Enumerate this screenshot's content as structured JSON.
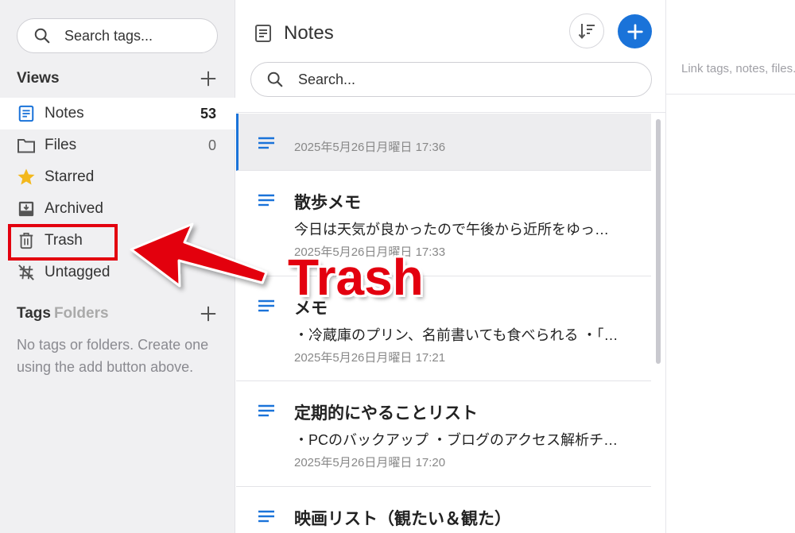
{
  "sidebar": {
    "search_placeholder": "Search tags...",
    "views_title": "Views",
    "items": [
      {
        "label": "Notes",
        "count": "53",
        "icon": "notes-icon"
      },
      {
        "label": "Files",
        "count": "0",
        "icon": "folder-icon"
      },
      {
        "label": "Starred",
        "count": "",
        "icon": "star-icon"
      },
      {
        "label": "Archived",
        "count": "",
        "icon": "archive-icon"
      },
      {
        "label": "Trash",
        "count": "",
        "icon": "trash-icon"
      },
      {
        "label": "Untagged",
        "count": "",
        "icon": "untagged-icon"
      }
    ],
    "tags_title": "Tags",
    "folders_title": "Folders",
    "empty_message": "No tags or folders. Create one using the add button above."
  },
  "notes_list": {
    "title": "Notes",
    "search_placeholder": "Search...",
    "notes": [
      {
        "title": "",
        "snippet": "",
        "date": "2025年5月26日月曜日 17:36"
      },
      {
        "title": "散歩メモ",
        "snippet": "今日は天気が良かったので午後から近所をゆっ…",
        "date": "2025年5月26日月曜日 17:33"
      },
      {
        "title": "メモ",
        "snippet": "・冷蔵庫のプリン、名前書いても食べられる ・「…",
        "date": "2025年5月26日月曜日 17:21"
      },
      {
        "title": "定期的にやることリスト",
        "snippet": "・PCのバックアップ ・ブログのアクセス解析チ…",
        "date": "2025年5月26日月曜日 17:20"
      },
      {
        "title": "映画リスト（観たい＆観た）",
        "snippet": "",
        "date": ""
      }
    ]
  },
  "editor": {
    "link_tags_placeholder": "Link tags, notes, files..."
  },
  "annotation": {
    "label": "Trash",
    "color": "#e3000f"
  },
  "colors": {
    "accent": "#1a73d9",
    "sidebar_bg": "#f0f0f2"
  }
}
